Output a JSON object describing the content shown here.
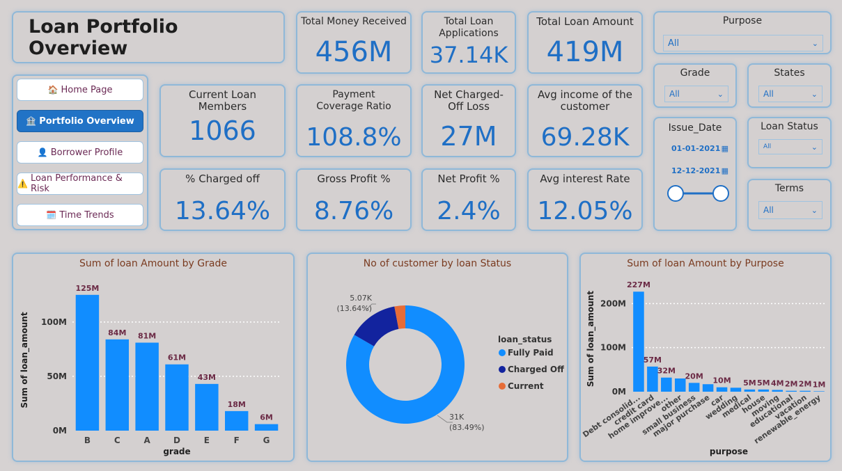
{
  "header": {
    "title": "Loan Portfolio Overview"
  },
  "nav": [
    {
      "icon": "🏠",
      "label": "Home Page",
      "active": false
    },
    {
      "icon": "🏦",
      "label": "Portfolio Overview",
      "active": true
    },
    {
      "icon": "👤",
      "label": "Borrower Profile",
      "active": false
    },
    {
      "icon": "⚠️",
      "label": "Loan Performance & Risk",
      "active": false
    },
    {
      "icon": "🗓️",
      "label": "Time Trends",
      "active": false
    }
  ],
  "kpis": {
    "total_money_received": {
      "label": "Total Money Received",
      "value": "456M"
    },
    "total_loan_applications": {
      "label": "Total Loan Applications",
      "value": "37.14K"
    },
    "total_loan_amount": {
      "label": "Total Loan Amount",
      "value": "419M"
    },
    "current_loan_members": {
      "label": "Current Loan Members",
      "value": "1066"
    },
    "payment_coverage_ratio": {
      "label": "Payment Coverage Ratio",
      "value": "108.8%"
    },
    "net_charged_off_loss": {
      "label": "Net Charged-Off Loss",
      "value": "27M"
    },
    "avg_income": {
      "label": "Avg income of the customer",
      "value": "69.28K"
    },
    "pct_charged_off": {
      "label": "% Charged off",
      "value": "13.64%"
    },
    "gross_profit_pct": {
      "label": "Gross Profit %",
      "value": "8.76%"
    },
    "net_profit_pct": {
      "label": "Net Profit %",
      "value": "2.4%"
    },
    "avg_interest_rate": {
      "label": "Avg interest Rate",
      "value": "12.05%"
    }
  },
  "slicers": {
    "purpose": {
      "title": "Purpose",
      "value": "All"
    },
    "grade": {
      "title": "Grade",
      "value": "All"
    },
    "states": {
      "title": "States",
      "value": "All"
    },
    "issue_date": {
      "title": "Issue_Date",
      "start": "01-01-2021",
      "end": "12-12-2021"
    },
    "loan_status": {
      "title": "Loan Status",
      "value": "All"
    },
    "terms": {
      "title": "Terms",
      "value": "All"
    }
  },
  "colors": {
    "accent": "#1f6fc5",
    "bar": "#118dff",
    "fully_paid": "#118dff",
    "charged_off": "#12239e",
    "current": "#e66c37"
  },
  "chart_data": [
    {
      "type": "bar",
      "title": "Sum of loan Amount by Grade",
      "xlabel": "grade",
      "ylabel": "Sum of loan_amount",
      "categories": [
        "B",
        "C",
        "A",
        "D",
        "E",
        "F",
        "G"
      ],
      "values": [
        125,
        84,
        81,
        61,
        43,
        18,
        6
      ],
      "data_labels": [
        "125M",
        "84M",
        "81M",
        "61M",
        "43M",
        "18M",
        "6M"
      ],
      "yticks": [
        "0M",
        "50M",
        "100M"
      ],
      "ylim": [
        0,
        130
      ],
      "grid": true
    },
    {
      "type": "pie",
      "title": "No of customer by loan Status",
      "legend_title": "loan_status",
      "legend_position": "right",
      "slices": [
        {
          "name": "Fully Paid",
          "value": 31000,
          "label": "31K",
          "pct": "(83.49%)"
        },
        {
          "name": "Charged Off",
          "value": 5070,
          "label": "5.07K",
          "pct": "(13.64%)"
        },
        {
          "name": "Current",
          "value": 1100,
          "label": "",
          "pct": ""
        }
      ]
    },
    {
      "type": "bar",
      "title": "Sum of loan Amount by Purpose",
      "xlabel": "purpose",
      "ylabel": "Sum of loan_amount",
      "categories": [
        "Debt consolid...",
        "credit card",
        "home improve...",
        "other",
        "small business",
        "major purchase",
        "car",
        "wedding",
        "medical",
        "house",
        "moving",
        "educational",
        "vacation",
        "renewable_energy"
      ],
      "values": [
        227,
        57,
        32,
        30,
        20,
        17,
        10,
        9,
        5,
        5,
        4,
        2,
        2,
        1
      ],
      "data_labels": [
        "227M",
        "57M",
        "32M",
        "",
        "20M",
        "",
        "10M",
        "",
        "5M",
        "5M",
        "4M",
        "2M",
        "2M",
        "1M"
      ],
      "yticks": [
        "0M",
        "100M",
        "200M"
      ],
      "ylim": [
        0,
        240
      ],
      "grid": true
    }
  ]
}
